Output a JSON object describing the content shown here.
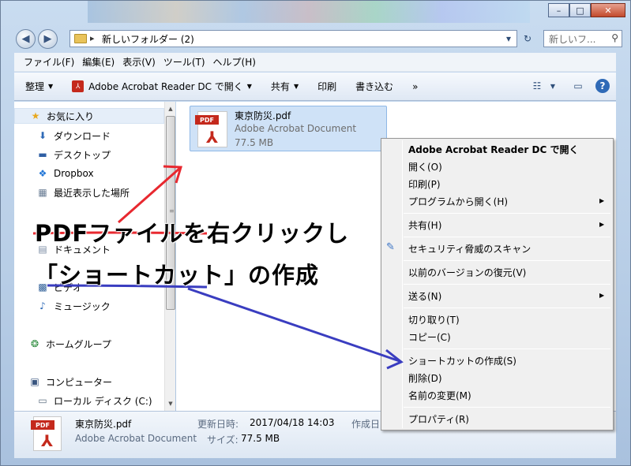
{
  "window": {
    "address": "新しいフォルダー (2)",
    "search_placeholder": "新しいフ...",
    "buttons": {
      "minimize": "–",
      "maximize": "□",
      "close": "✕"
    }
  },
  "menubar": [
    "ファイル(F)",
    "編集(E)",
    "表示(V)",
    "ツール(T)",
    "ヘルプ(H)"
  ],
  "toolbar": {
    "organize": "整理",
    "open_with": "Adobe Acrobat Reader DC で開く",
    "share": "共有",
    "print": "印刷",
    "burn": "書き込む",
    "more": "»"
  },
  "sidebar": {
    "favorites": "お気に入り",
    "downloads": "ダウンロード",
    "desktop": "デスクトップ",
    "dropbox": "Dropbox",
    "recent": "最近表示した場所",
    "documents": "ドキュメント",
    "videos": "ビデオ",
    "music": "ミュージック",
    "homegroup": "ホームグループ",
    "computer": "コンピューター",
    "local_disk": "ローカル ディスク (C:)"
  },
  "file": {
    "name": "東京防災.pdf",
    "type": "Adobe Acrobat Document",
    "size": "77.5 MB",
    "icon_label": "PDF"
  },
  "status": {
    "name": "東京防災.pdf",
    "type": "Adobe Acrobat Document",
    "modified_label": "更新日時:",
    "modified_value": "2017/04/18 14:03",
    "size_label": "サイズ:",
    "size_value": "77.5 MB",
    "created_label": "作成日"
  },
  "context_menu": {
    "open_acrobat": "Adobe Acrobat Reader DC で開く",
    "open": "開く(O)",
    "print": "印刷(P)",
    "open_with": "プログラムから開く(H)",
    "share": "共有(H)",
    "scan": "セキュリティ脅威のスキャン",
    "restore": "以前のバージョンの復元(V)",
    "send_to": "送る(N)",
    "cut": "切り取り(T)",
    "copy": "コピー(C)",
    "create_shortcut": "ショートカットの作成(S)",
    "delete": "削除(D)",
    "rename": "名前の変更(M)",
    "properties": "プロパティ(R)"
  },
  "annotation": {
    "line1": "PDFファイルを右クリックし",
    "line2": "「ショートカット」の作成",
    "colors": {
      "red": "#e8282f",
      "blue": "#3a3dc0"
    }
  }
}
